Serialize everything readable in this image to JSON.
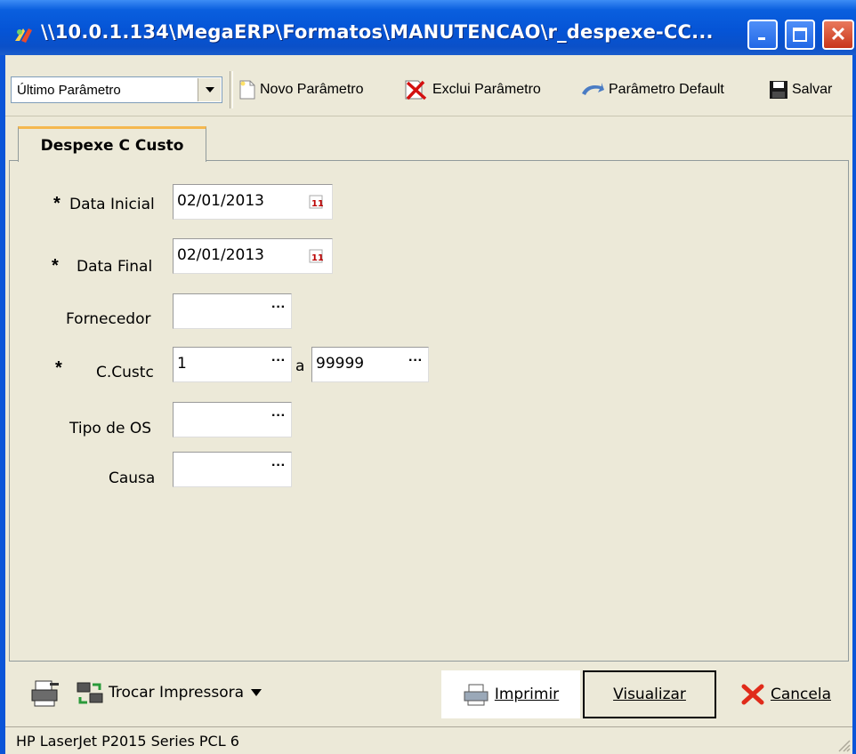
{
  "window": {
    "title": "\\\\10.0.1.134\\MegaERP\\Formatos\\MANUTENCAO\\r_despexe-CC...",
    "close_glyph": "✕"
  },
  "toolbar": {
    "param_select_value": "Último Parâmetro",
    "new_param_label": "Novo Parâmetro",
    "delete_param_label": "Exclui Parâmetro",
    "default_param_label": "Parâmetro Default",
    "save_label": "Salvar"
  },
  "tabs": [
    {
      "label": "Despexe C Custo",
      "active": true
    }
  ],
  "form": {
    "data_inicial": {
      "required": "*",
      "label": "Data Inicial",
      "value": "02/01/2013"
    },
    "data_final": {
      "required": "*",
      "label": "Data Final",
      "value": "02/01/2013"
    },
    "fornecedor": {
      "label": "Fornecedor",
      "value": ""
    },
    "ccusto": {
      "required": "*",
      "label": "C.Custc",
      "from_value": "1",
      "separator": "a",
      "to_value": "99999"
    },
    "tipo_os": {
      "label": "Tipo de OS",
      "value": ""
    },
    "causa": {
      "label": "Causa",
      "value": ""
    },
    "lookup_glyph": "···"
  },
  "footer": {
    "change_printer_label": "Trocar Impressora",
    "print_label": "Imprimir",
    "preview_label": "Visualizar",
    "cancel_label": "Cancela"
  },
  "status_bar": {
    "printer_name": "HP LaserJet P2015 Series PCL 6"
  },
  "colors": {
    "titlebar": "#0554d6",
    "window_bg": "#ece9d8",
    "close_button": "#c8361a",
    "tab_accent": "#f5b84f"
  }
}
